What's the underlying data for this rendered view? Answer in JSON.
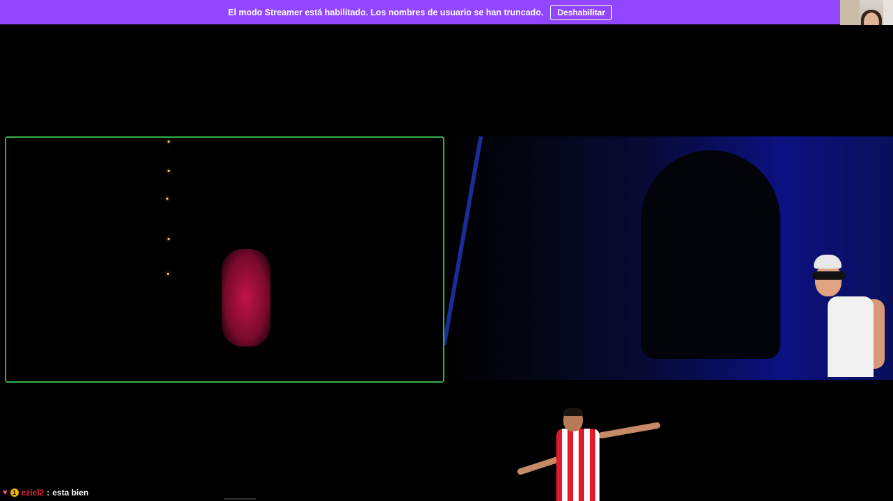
{
  "banner": {
    "message": "El modo Streamer está habilitado. Los nombres de usuario se han truncado.",
    "button_label": "Deshabilitar",
    "color": "#9147ff"
  },
  "chat": {
    "heart_icon": "♥",
    "badge_text": "1",
    "username": "eziel2",
    "separator": ":",
    "message": "esta bien"
  },
  "colors": {
    "left_video_border": "#35b04a",
    "username": "#e0223e"
  },
  "icons": [
    "heart-icon",
    "sub-badge-icon"
  ]
}
